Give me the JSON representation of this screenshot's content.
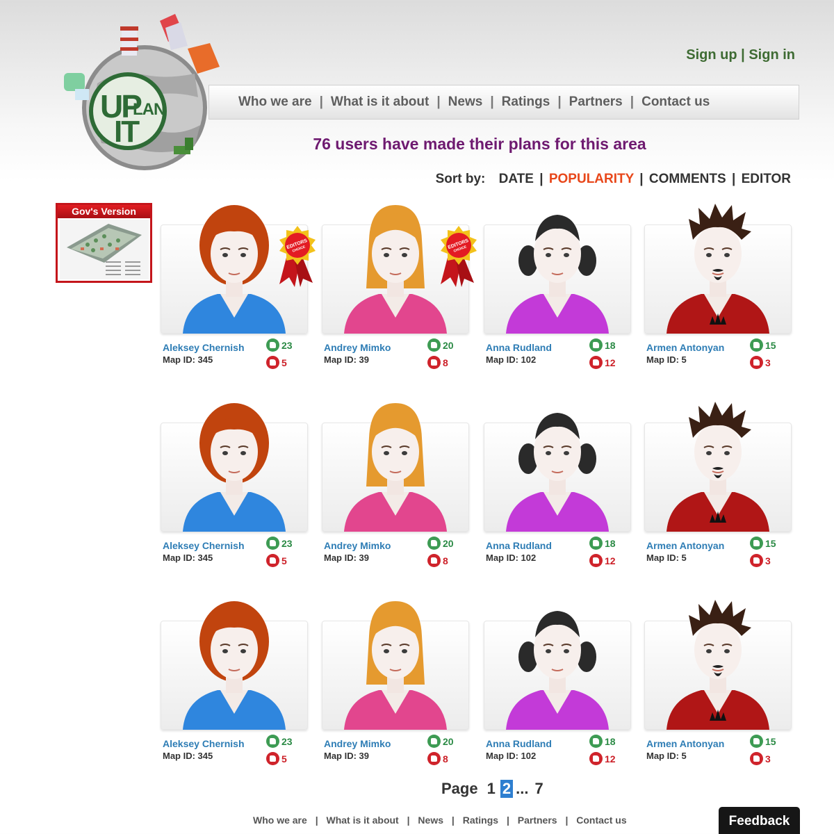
{
  "logo": {
    "part1": "UP",
    "part2": "LAN",
    "part3": "IT"
  },
  "header": {
    "signup": "Sign up",
    "auth_sep": "|",
    "signin": "Sign in",
    "nav": [
      "Who we are",
      "What is it about",
      "News",
      "Ratings",
      "Partners",
      "Contact us"
    ],
    "nav_sep": "|"
  },
  "headline": "76 users have made their plans for this area",
  "sort": {
    "label": "Sort by:",
    "options": [
      "DATE",
      "POPULARITY",
      "COMMENTS",
      "EDITOR"
    ],
    "active": "POPULARITY",
    "sep": "|"
  },
  "gov_version": {
    "title": "Gov's Version"
  },
  "colors": {
    "accent": "#e8471a",
    "brand_green": "#3e6b33",
    "headline": "#6e1a70",
    "link": "#2e7db5",
    "up": "#2b8a45",
    "down": "#cc1f27"
  },
  "rows": [
    [
      {
        "name": "Aleksey Chernish",
        "map_label": "Map ID: 345",
        "likes": "23",
        "dislikes": "5",
        "editors_choice": true,
        "avatar": "curly-red-hair-blue-shirt"
      },
      {
        "name": "Andrey Mimko",
        "map_label": "Map ID: 39",
        "likes": "20",
        "dislikes": "8",
        "editors_choice": true,
        "avatar": "long-blonde-hair-pink-shirt"
      },
      {
        "name": "Anna Rudland",
        "map_label": "Map ID: 102",
        "likes": "18",
        "dislikes": "12",
        "editors_choice": false,
        "avatar": "pigtails-purple-shirt"
      },
      {
        "name": "Armen Antonyan",
        "map_label": "Map ID: 5",
        "likes": "15",
        "dislikes": "3",
        "editors_choice": false,
        "avatar": "spiky-hair-red-shirt"
      }
    ],
    [
      {
        "name": "Aleksey Chernish",
        "map_label": "Map ID: 345",
        "likes": "23",
        "dislikes": "5",
        "editors_choice": false,
        "avatar": "curly-red-hair-blue-shirt"
      },
      {
        "name": "Andrey Mimko",
        "map_label": "Map ID: 39",
        "likes": "20",
        "dislikes": "8",
        "editors_choice": false,
        "avatar": "long-blonde-hair-pink-shirt"
      },
      {
        "name": "Anna Rudland",
        "map_label": "Map ID: 102",
        "likes": "18",
        "dislikes": "12",
        "editors_choice": false,
        "avatar": "pigtails-purple-shirt"
      },
      {
        "name": "Armen Antonyan",
        "map_label": "Map ID: 5",
        "likes": "15",
        "dislikes": "3",
        "editors_choice": false,
        "avatar": "spiky-hair-red-shirt"
      }
    ],
    [
      {
        "name": "Aleksey Chernish",
        "map_label": "Map ID: 345",
        "likes": "23",
        "dislikes": "5",
        "editors_choice": false,
        "avatar": "curly-red-hair-blue-shirt"
      },
      {
        "name": "Andrey Mimko",
        "map_label": "Map ID: 39",
        "likes": "20",
        "dislikes": "8",
        "editors_choice": false,
        "avatar": "long-blonde-hair-pink-shirt"
      },
      {
        "name": "Anna Rudland",
        "map_label": "Map ID: 102",
        "likes": "18",
        "dislikes": "12",
        "editors_choice": false,
        "avatar": "pigtails-purple-shirt"
      },
      {
        "name": "Armen Antonyan",
        "map_label": "Map ID: 5",
        "likes": "15",
        "dislikes": "3",
        "editors_choice": false,
        "avatar": "spiky-hair-red-shirt"
      }
    ]
  ],
  "pagination": {
    "label": "Page",
    "pages": [
      "1",
      "2"
    ],
    "current": "2",
    "ellipsis": "...",
    "last": "7"
  },
  "footer": {
    "links": [
      "Who we are",
      "What is it about",
      "News",
      "Ratings",
      "Partners",
      "Contact us"
    ],
    "sep": "|"
  },
  "feedback": "Feedback"
}
